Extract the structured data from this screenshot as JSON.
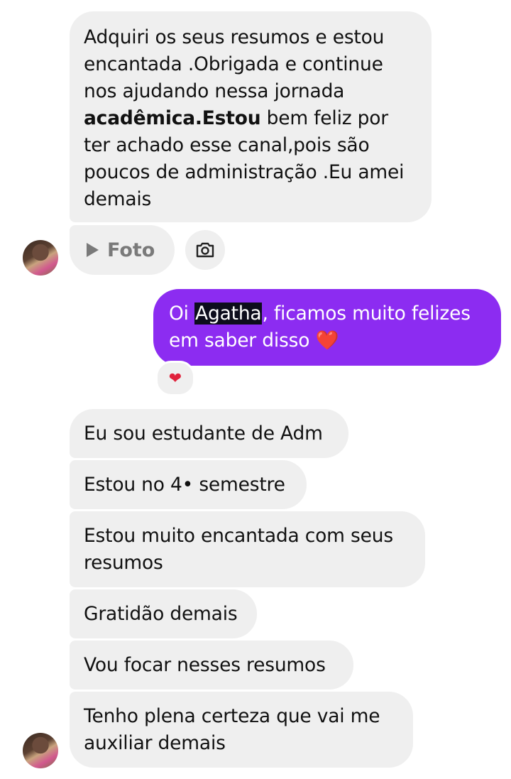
{
  "received_first": {
    "text_before_bold": "Adquiri os seus resumos e estou\nencantada .Obrigada e continue\nnos ajudando nessa jornada\n",
    "bold_text": "acadêmica.Estou",
    "text_after_bold": " bem feliz por\nter achado esse canal,pois são\npoucos de administração .Eu amei\ndemais"
  },
  "photo_message": {
    "label": "Foto",
    "icon": "play-icon"
  },
  "camera_button": {
    "icon": "camera-icon"
  },
  "sent_message": {
    "prefix": "Oi ",
    "highlighted_name": "Agatha",
    "rest": ", ficamos muito felizes\nem saber disso ",
    "emoji": "❤️"
  },
  "reaction": {
    "emoji": "❤"
  },
  "received_messages": [
    "Eu sou estudante de Adm",
    "Estou no 4• semestre",
    "Estou muito encantada com seus\nresumos",
    "Gratidão demais",
    "Vou focar nesses resumos",
    "Tenho plena certeza que vai me\nauxiliar demais"
  ],
  "colors": {
    "sent_bubble": "#8c2cf1",
    "received_bubble": "#efefef",
    "heart": "#e0223c"
  }
}
